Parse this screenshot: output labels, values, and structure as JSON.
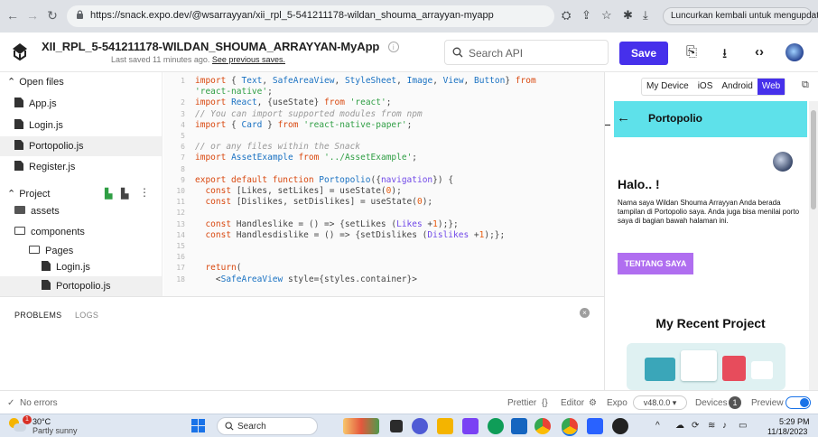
{
  "browser": {
    "url": "https://snack.expo.dev/@wsarrayyan/xii_rpl_5-541211178-wildan_shouma_arrayyan-myapp",
    "relaunch_label": "Luncurkan kembali untuk mengupdate"
  },
  "header": {
    "title": "XII_RPL_5-541211178-WILDAN_SHOUMA_ARRAYYAN-MyApp",
    "saved_text": "Last saved 11 minutes ago.",
    "saved_link": "See previous saves.",
    "search_placeholder": "Search API",
    "save_label": "Save"
  },
  "sidebar": {
    "open_files_label": "Open files",
    "open_files": [
      "App.js",
      "Login.js",
      "Portopolio.js",
      "Register.js"
    ],
    "project_label": "Project",
    "tree": {
      "assets": "assets",
      "components": "components",
      "pages": "Pages",
      "login": "Login.js",
      "portopolio": "Portopolio.js"
    }
  },
  "editor": {
    "line_numbers": [
      "1",
      "",
      "2",
      "3",
      "4",
      "5",
      "6",
      "7",
      "8",
      "9",
      "10",
      "11",
      "12",
      "13",
      "14",
      "15",
      "16",
      "17",
      "18"
    ]
  },
  "panel": {
    "problems_tab": "PROBLEMS",
    "logs_tab": "LOGS"
  },
  "statusbar": {
    "no_errors": "No errors",
    "prettier": "Prettier",
    "editor": "Editor",
    "expo": "Expo",
    "version": "v48.0.0 ▾",
    "devices": "Devices",
    "devices_count": "1",
    "preview": "Preview"
  },
  "preview": {
    "tabs": [
      "My Device",
      "iOS",
      "Android",
      "Web"
    ],
    "active_tab": "Web",
    "appbar_title": "Portopolio",
    "greeting": "Halo.. !",
    "intro": "Nama saya Wildan Shouma Arrayyan Anda berada tampilan di Portopolio saya. Anda juga bisa menilai porto saya di bagian bawah halaman ini.",
    "about_button": "TENTANG SAYA",
    "recent_title": "My Recent Project"
  },
  "taskbar": {
    "weather_temp": "30°C",
    "weather_desc": "Partly sunny",
    "weather_badge": "1",
    "search_label": "Search",
    "time": "5:29 PM",
    "date": "11/18/2023"
  },
  "colors": {
    "save_button": "#4630eb",
    "appbar": "#5ee1ea",
    "about_button": "#b06ef0",
    "web_tab": "#4630eb"
  }
}
